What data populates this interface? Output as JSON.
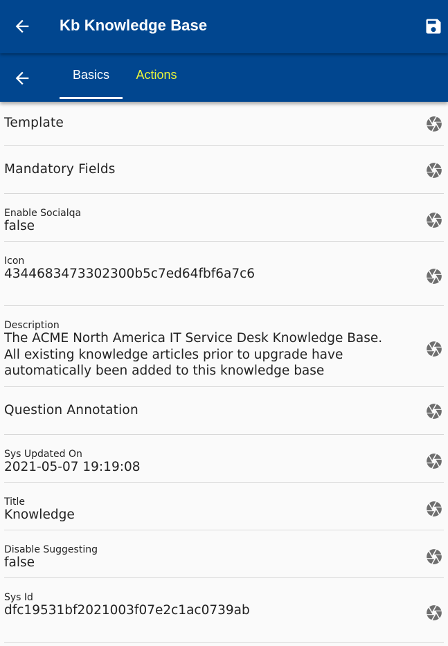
{
  "header": {
    "title": "Kb Knowledge Base",
    "back_icon": "arrow-left-icon",
    "save_icon": "floppy-disk-icon"
  },
  "tabs": {
    "back_icon": "arrow-left-icon",
    "items": [
      {
        "label": "Basics",
        "active": true
      },
      {
        "label": "Actions",
        "active": false
      }
    ]
  },
  "fields": [
    {
      "type": "heading",
      "label": "Template"
    },
    {
      "type": "heading",
      "label": "Mandatory Fields"
    },
    {
      "type": "field",
      "label": "Enable Socialqa",
      "value": "false"
    },
    {
      "type": "field",
      "label": "Icon",
      "value": "4344683473302300b5c7ed64fbf6a7c6"
    },
    {
      "type": "field",
      "label": "Description",
      "value": "The ACME North America IT Service Desk Knowledge Base.\nAll existing knowledge articles prior to upgrade have\nautomatically been added to this knowledge base"
    },
    {
      "type": "heading",
      "label": "Question Annotation"
    },
    {
      "type": "field",
      "label": "Sys Updated On",
      "value": "2021-05-07 19:19:08"
    },
    {
      "type": "field",
      "label": "Title",
      "value": "Knowledge"
    },
    {
      "type": "field",
      "label": "Disable Suggesting",
      "value": "false"
    },
    {
      "type": "field",
      "label": "Sys Id",
      "value": "dfc19531bf2021003f07e2c1ac0739ab"
    }
  ],
  "row_icon": "camera-aperture-icon",
  "colors": {
    "appbar": "#01468f",
    "active_tab": "#ffffff",
    "inactive_tab": "#e8f33b",
    "background": "#fafafa",
    "divider": "#d8d8d8"
  }
}
